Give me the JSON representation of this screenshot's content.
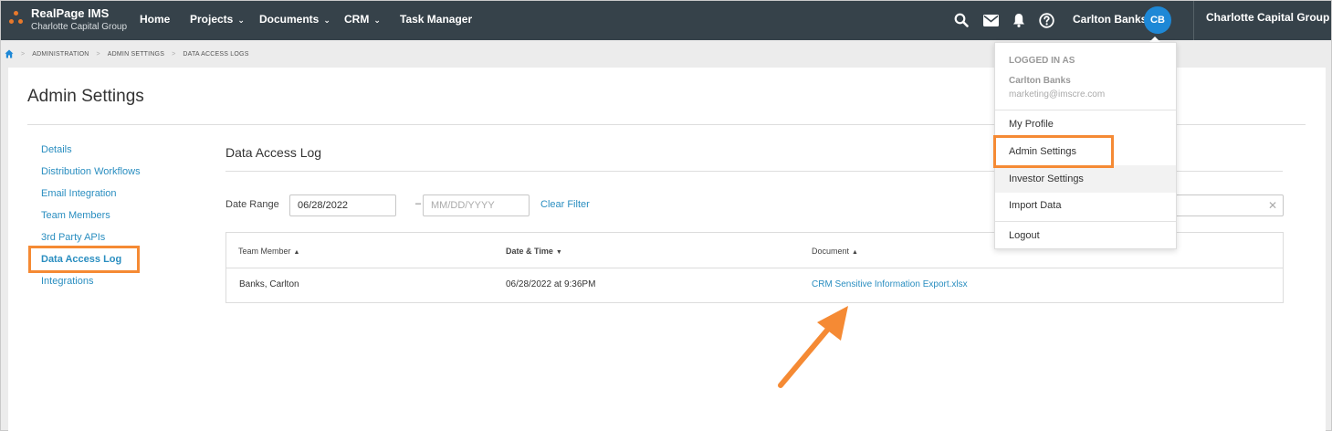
{
  "app": {
    "brand_title": "RealPage IMS",
    "brand_subtitle": "Charlotte Capital Group",
    "accent_color": "#f58a34",
    "nav_bg": "#36424a",
    "link_color": "#2a8ec0"
  },
  "nav": {
    "items": [
      {
        "label": "Home"
      },
      {
        "label": "Projects"
      },
      {
        "label": "Documents"
      },
      {
        "label": "CRM"
      },
      {
        "label": "Task Manager"
      }
    ],
    "icons": [
      "search-icon",
      "mail-icon",
      "bell-icon",
      "help-icon"
    ],
    "user_name": "Carlton Banks",
    "avatar_initials": "CB",
    "org_switcher": "Charlotte Capital Group"
  },
  "breadcrumb": {
    "items": [
      "ADMINISTRATION",
      "ADMIN SETTINGS",
      "DATA ACCESS LOGS"
    ]
  },
  "page": {
    "title": "Admin Settings"
  },
  "sidebar": {
    "items": [
      {
        "label": "Details"
      },
      {
        "label": "Distribution Workflows"
      },
      {
        "label": "Email Integration"
      },
      {
        "label": "Team Members"
      },
      {
        "label": "3rd Party APIs"
      },
      {
        "label": "Data Access Log"
      },
      {
        "label": "Integrations"
      }
    ],
    "active": "Data Access Log"
  },
  "section": {
    "title": "Data Access Log",
    "filter": {
      "date_range_label": "Date Range",
      "start_value": "06/28/2022",
      "end_placeholder": "MM/DD/YYYY",
      "dash": "–",
      "clear_label": "Clear Filter"
    }
  },
  "table": {
    "columns": [
      {
        "label": "Team Member",
        "sort": "▲"
      },
      {
        "label": "Date & Time",
        "sort": "▼"
      },
      {
        "label": "Document",
        "sort": "▲"
      }
    ],
    "rows": [
      {
        "member": "Banks, Carlton",
        "datetime": "06/28/2022 at 9:36PM",
        "document": "CRM Sensitive Information Export.xlsx"
      }
    ]
  },
  "user_menu": {
    "header": "LOGGED IN AS",
    "name": "Carlton Banks",
    "email": "marketing@imscre.com",
    "items": [
      {
        "label": "My Profile"
      },
      {
        "label": "Admin Settings"
      },
      {
        "label": "Investor Settings"
      },
      {
        "label": "Import Data"
      },
      {
        "label": "Logout"
      }
    ]
  }
}
